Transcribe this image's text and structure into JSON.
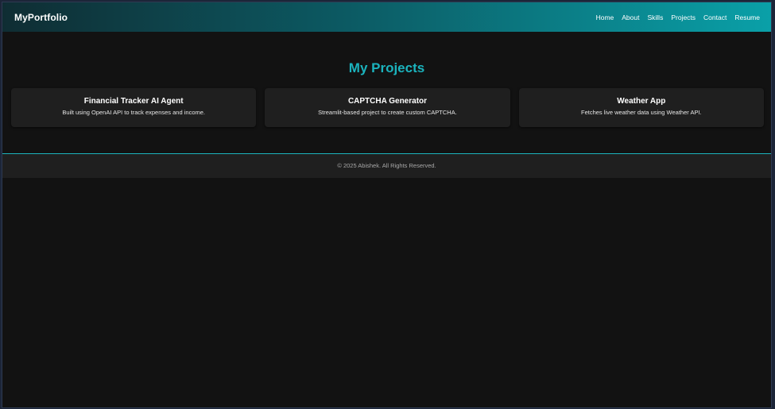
{
  "navbar": {
    "brand": "MyPortfolio",
    "links": [
      "Home",
      "About",
      "Skills",
      "Projects",
      "Contact",
      "Resume"
    ]
  },
  "projects": {
    "title": "My Projects",
    "cards": [
      {
        "title": "Financial Tracker AI Agent",
        "description": "Built using OpenAI API to track expenses and income."
      },
      {
        "title": "CAPTCHA Generator",
        "description": "Streamlit-based project to create custom CAPTCHA."
      },
      {
        "title": "Weather App",
        "description": "Fetches live weather data using Weather API."
      }
    ]
  },
  "footer": {
    "text": "© 2025 Abishek. All Rights Reserved."
  },
  "colors": {
    "accent": "#1bb3bd",
    "background": "#121212",
    "card": "#1f1f1f"
  }
}
